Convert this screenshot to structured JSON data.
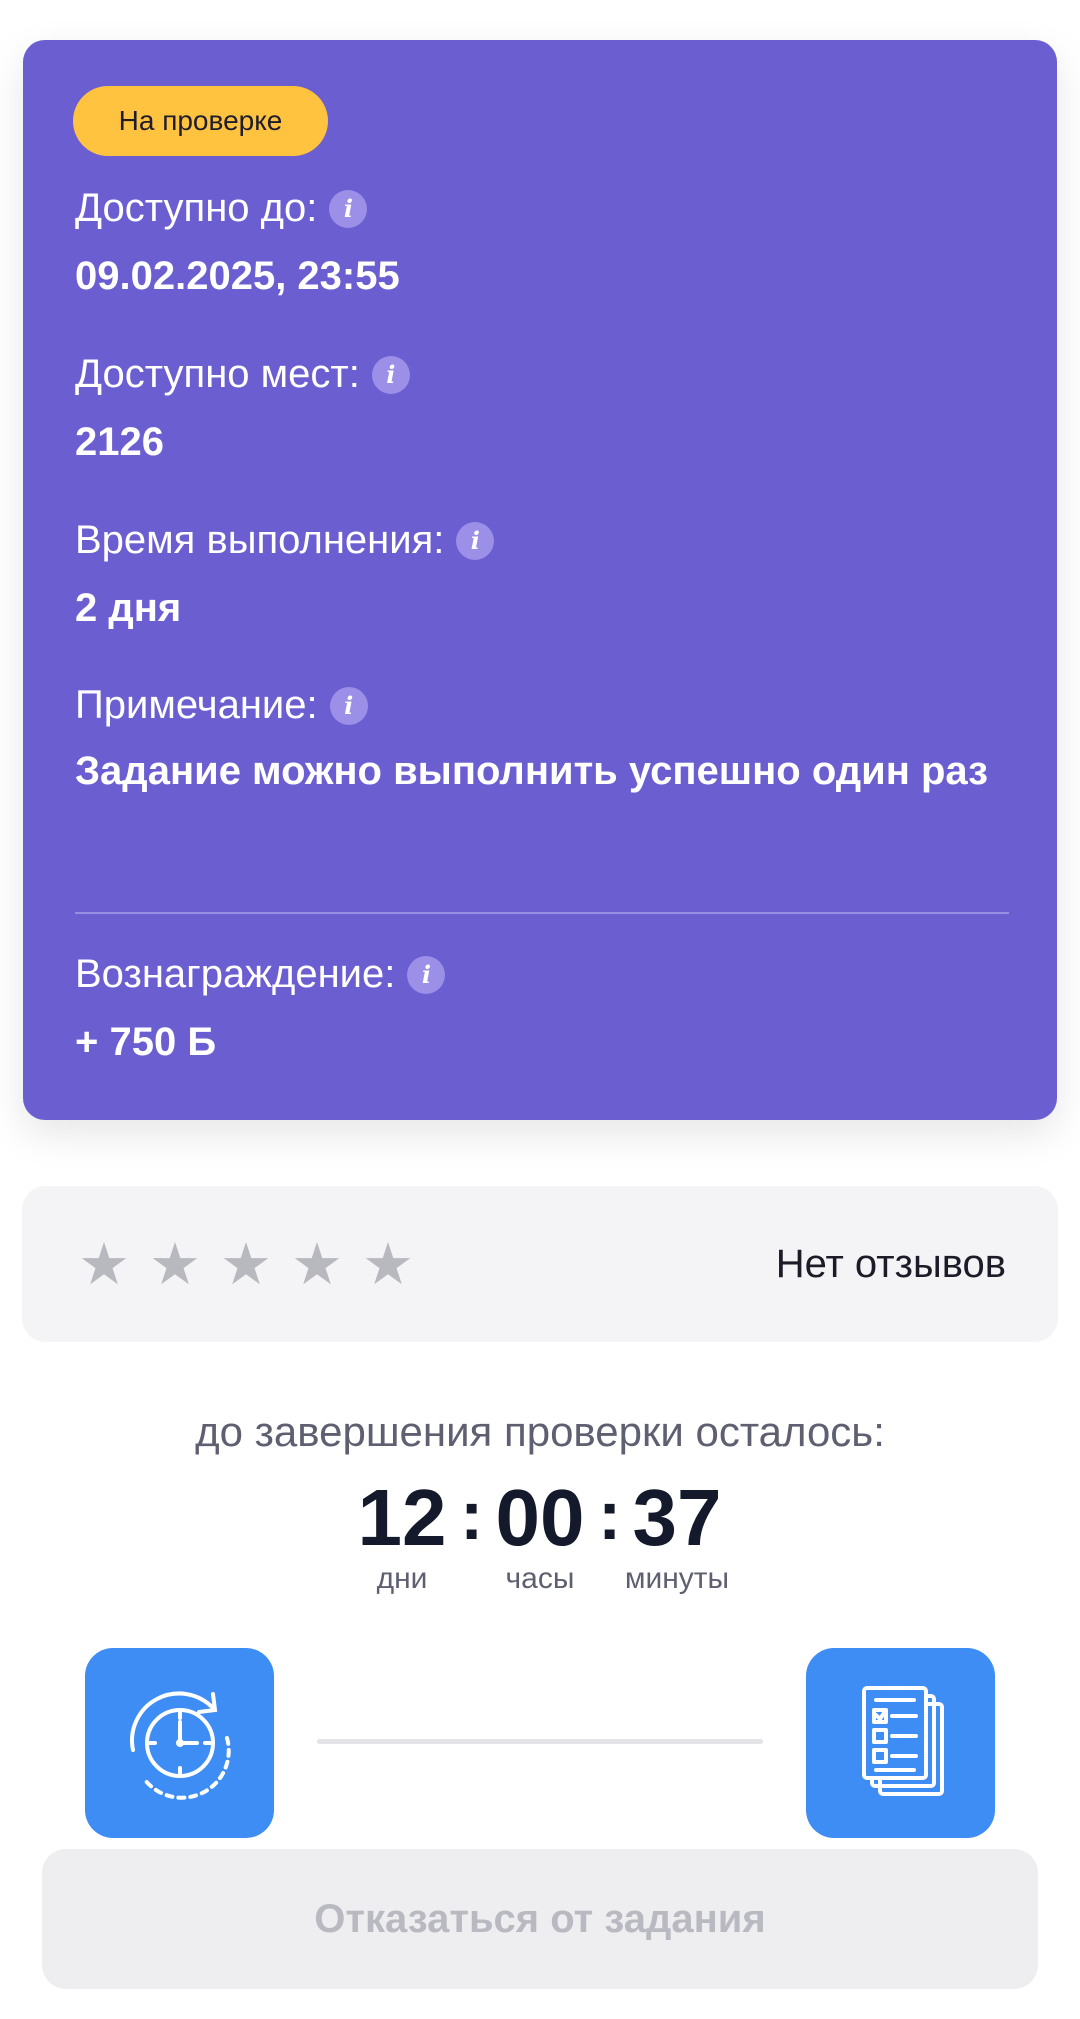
{
  "task": {
    "status_badge": "На проверке",
    "available_until_label": "Доступно до:",
    "available_until_value": "09.02.2025, 23:55",
    "places_label": "Доступно мест:",
    "places_value": "2126",
    "duration_label": "Время выполнения:",
    "duration_value": "2 дня",
    "note_label": "Примечание:",
    "note_value": "Задание можно выполнить успешно один раз",
    "reward_label": "Вознаграждение:",
    "reward_value": "+ 750 Б",
    "info_icon_glyph": "i"
  },
  "rating": {
    "stars_filled": 0,
    "stars_total": 5,
    "star_glyph": "★",
    "no_reviews_text": "Нет отзывов"
  },
  "countdown": {
    "caption": "до завершения проверки осталось:",
    "days": "12",
    "days_label": "дни",
    "hours": "00",
    "hours_label": "часы",
    "minutes": "37",
    "minutes_label": "минуты",
    "separator": ":"
  },
  "actions": {
    "left_icon": "clock-refresh-icon",
    "right_icon": "checklist-documents-icon",
    "decline_label": "Отказаться от задания"
  },
  "colors": {
    "card_bg": "#6b5ed1",
    "badge_bg": "#ffc33f",
    "tile_bg": "#3d8df5",
    "star_empty": "#b8b8bf"
  }
}
